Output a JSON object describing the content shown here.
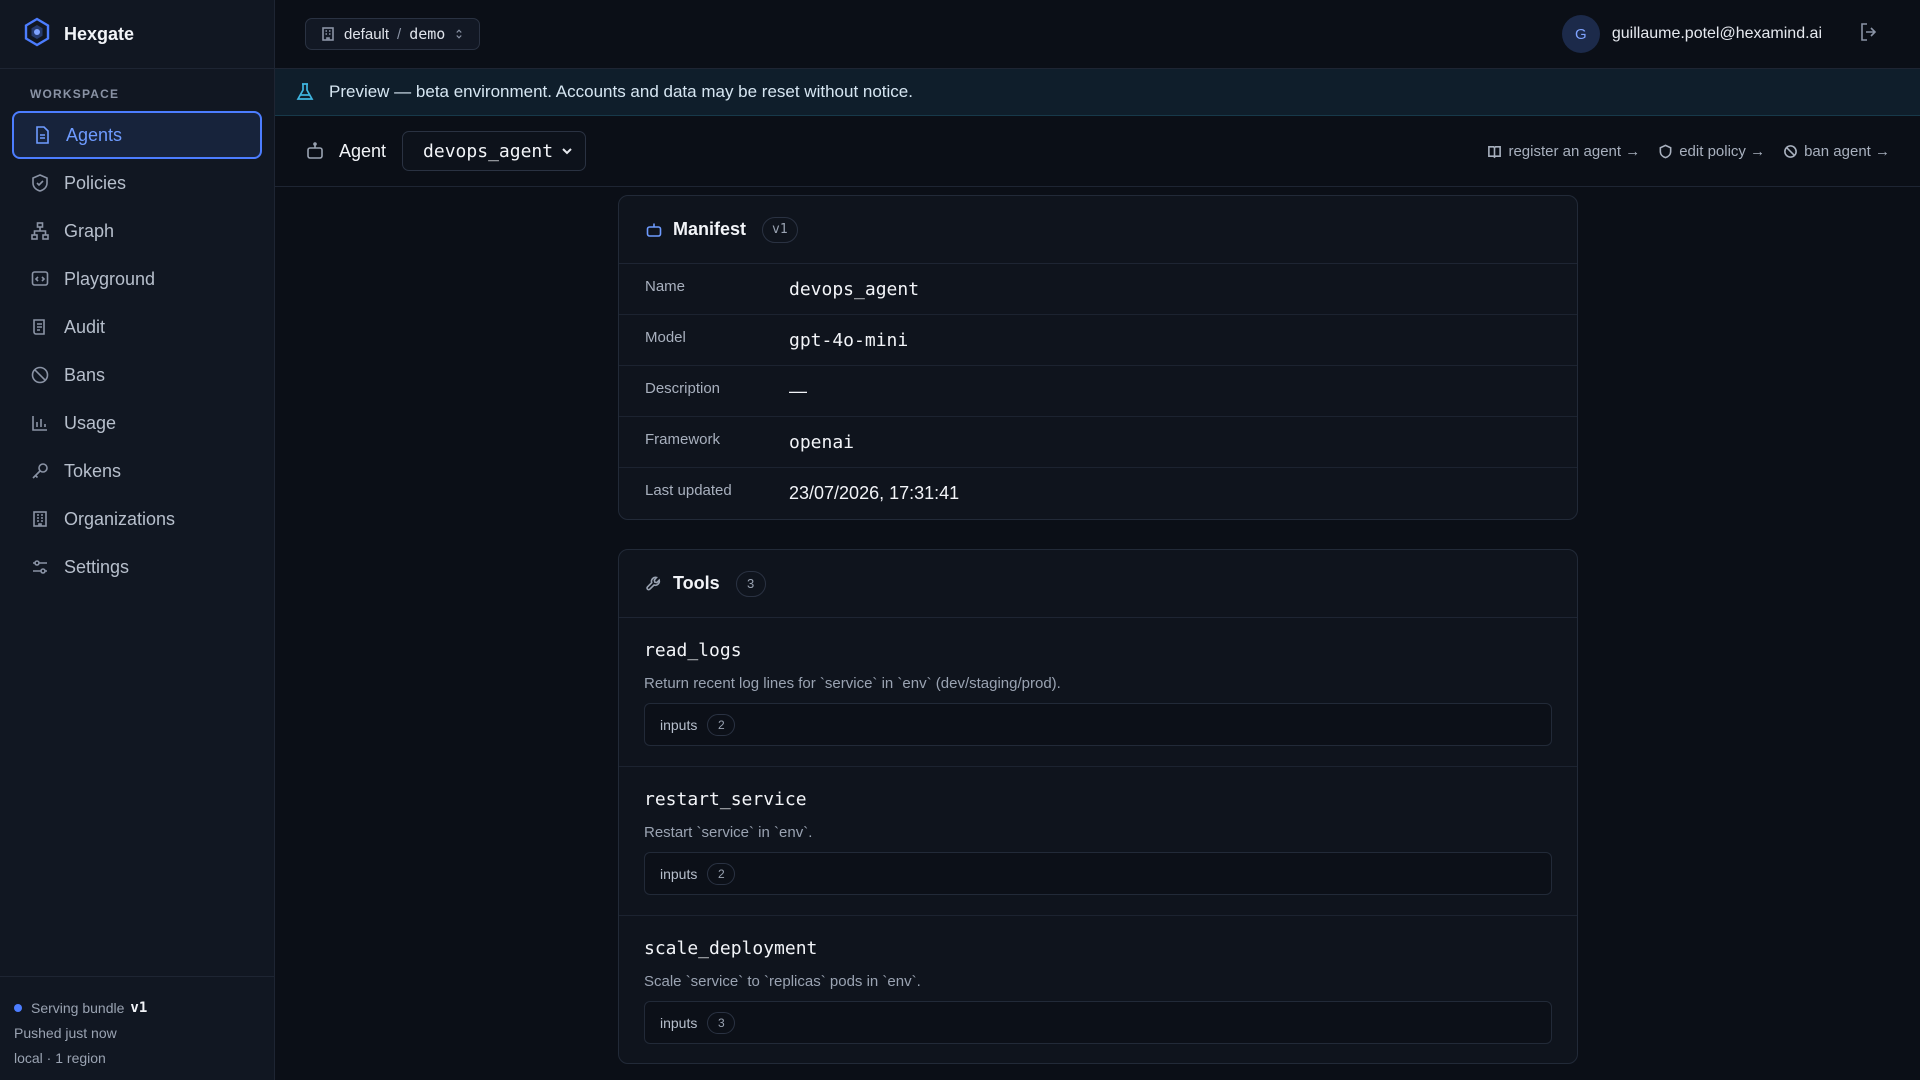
{
  "app": {
    "name": "Hexgate"
  },
  "sidebar": {
    "section_label": "WORKSPACE",
    "items": [
      {
        "label": "Agents",
        "icon": "file-icon",
        "active": true
      },
      {
        "label": "Policies",
        "icon": "shield-icon"
      },
      {
        "label": "Graph",
        "icon": "graph-icon"
      },
      {
        "label": "Playground",
        "icon": "playground-icon"
      },
      {
        "label": "Audit",
        "icon": "audit-icon"
      },
      {
        "label": "Bans",
        "icon": "ban-icon"
      },
      {
        "label": "Usage",
        "icon": "bar-chart-icon"
      },
      {
        "label": "Tokens",
        "icon": "key-icon"
      },
      {
        "label": "Organizations",
        "icon": "building-icon"
      },
      {
        "label": "Settings",
        "icon": "sliders-icon"
      }
    ],
    "footer": {
      "serving_label": "Serving bundle",
      "bundle_version": "v1",
      "pushed": "Pushed just now",
      "region": "local · 1 region"
    }
  },
  "topbar": {
    "org": "default",
    "separator": "/",
    "project": "demo",
    "user_initial": "G",
    "user_email": "guillaume.potel@hexamind.ai"
  },
  "banner": {
    "text": "Preview — beta environment. Accounts and data may be reset without notice."
  },
  "agentbar": {
    "label": "Agent",
    "selected_agent": "devops_agent",
    "links": [
      {
        "label": "register an agent →",
        "icon": "book-icon"
      },
      {
        "label": "edit policy →",
        "icon": "shield-icon"
      },
      {
        "label": "ban agent →",
        "icon": "ban-icon"
      }
    ]
  },
  "manifest": {
    "title": "Manifest",
    "version": "v1",
    "fields": [
      {
        "key": "Name",
        "value": "devops_agent",
        "mono": true
      },
      {
        "key": "Model",
        "value": "gpt-4o-mini",
        "mono": true
      },
      {
        "key": "Description",
        "value": "—",
        "mono": false
      },
      {
        "key": "Framework",
        "value": "openai",
        "mono": true
      },
      {
        "key": "Last updated",
        "value": "23/07/2026, 17:31:41",
        "mono": false
      }
    ]
  },
  "tools": {
    "title": "Tools",
    "count": "3",
    "items": [
      {
        "name": "read_logs",
        "description": "Return recent log lines for `service` in `env` (dev/staging/prod).",
        "inputs_label": "inputs",
        "inputs_count": "2"
      },
      {
        "name": "restart_service",
        "description": "Restart `service` in `env`.",
        "inputs_label": "inputs",
        "inputs_count": "2"
      },
      {
        "name": "scale_deployment",
        "description": "Scale `service` to `replicas` pods in `env`.",
        "inputs_label": "inputs",
        "inputs_count": "3"
      }
    ]
  },
  "colors": {
    "accent": "#4c7dff",
    "banner_icon": "#3fb5e0",
    "background": "#0b0f17"
  }
}
